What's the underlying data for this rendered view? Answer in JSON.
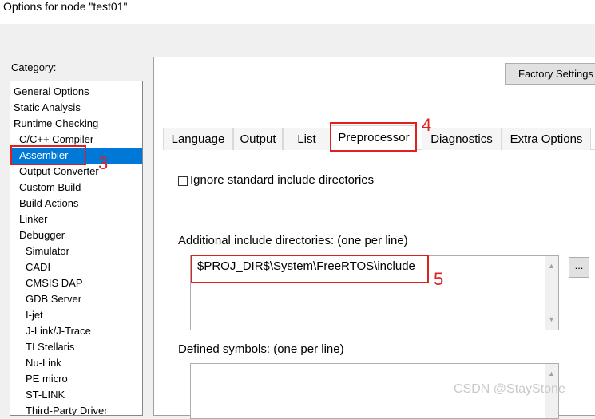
{
  "window": {
    "title": "Options for node \"test01\""
  },
  "category": {
    "label": "Category:",
    "items": [
      {
        "label": "General Options",
        "level": 0
      },
      {
        "label": "Static Analysis",
        "level": 0
      },
      {
        "label": "Runtime Checking",
        "level": 0
      },
      {
        "label": "C/C++ Compiler",
        "level": 1
      },
      {
        "label": "Assembler",
        "level": 1,
        "selected": true
      },
      {
        "label": "Output Converter",
        "level": 1
      },
      {
        "label": "Custom Build",
        "level": 1
      },
      {
        "label": "Build Actions",
        "level": 1
      },
      {
        "label": "Linker",
        "level": 1
      },
      {
        "label": "Debugger",
        "level": 1
      },
      {
        "label": "Simulator",
        "level": 2
      },
      {
        "label": "CADI",
        "level": 2
      },
      {
        "label": "CMSIS DAP",
        "level": 2
      },
      {
        "label": "GDB Server",
        "level": 2
      },
      {
        "label": "I-jet",
        "level": 2
      },
      {
        "label": "J-Link/J-Trace",
        "level": 2
      },
      {
        "label": "TI Stellaris",
        "level": 2
      },
      {
        "label": "Nu-Link",
        "level": 2
      },
      {
        "label": "PE micro",
        "level": 2
      },
      {
        "label": "ST-LINK",
        "level": 2
      },
      {
        "label": "Third-Party Driver",
        "level": 2
      }
    ]
  },
  "factory_settings_label": "Factory Settings",
  "tabs": [
    {
      "label": "Language"
    },
    {
      "label": "Output"
    },
    {
      "label": "List"
    },
    {
      "label": "Preprocessor",
      "active": true
    },
    {
      "label": "Diagnostics"
    },
    {
      "label": "Extra Options"
    }
  ],
  "preprocessor": {
    "ignore_std_label": "Ignore standard include directories",
    "ignore_std_checked": false,
    "include_dirs_label": "Additional include directories:  (one per line)",
    "include_dirs_value": "$PROJ_DIR$\\System\\FreeRTOS\\include",
    "browse_label": "...",
    "defined_symbols_label": "Defined symbols:  (one per line)",
    "defined_symbols_value": ""
  },
  "annotations": [
    "3",
    "4",
    "5"
  ],
  "annotation_color": "#e02020",
  "selection_color": "#0078d7",
  "watermark": "CSDN @StayStone"
}
